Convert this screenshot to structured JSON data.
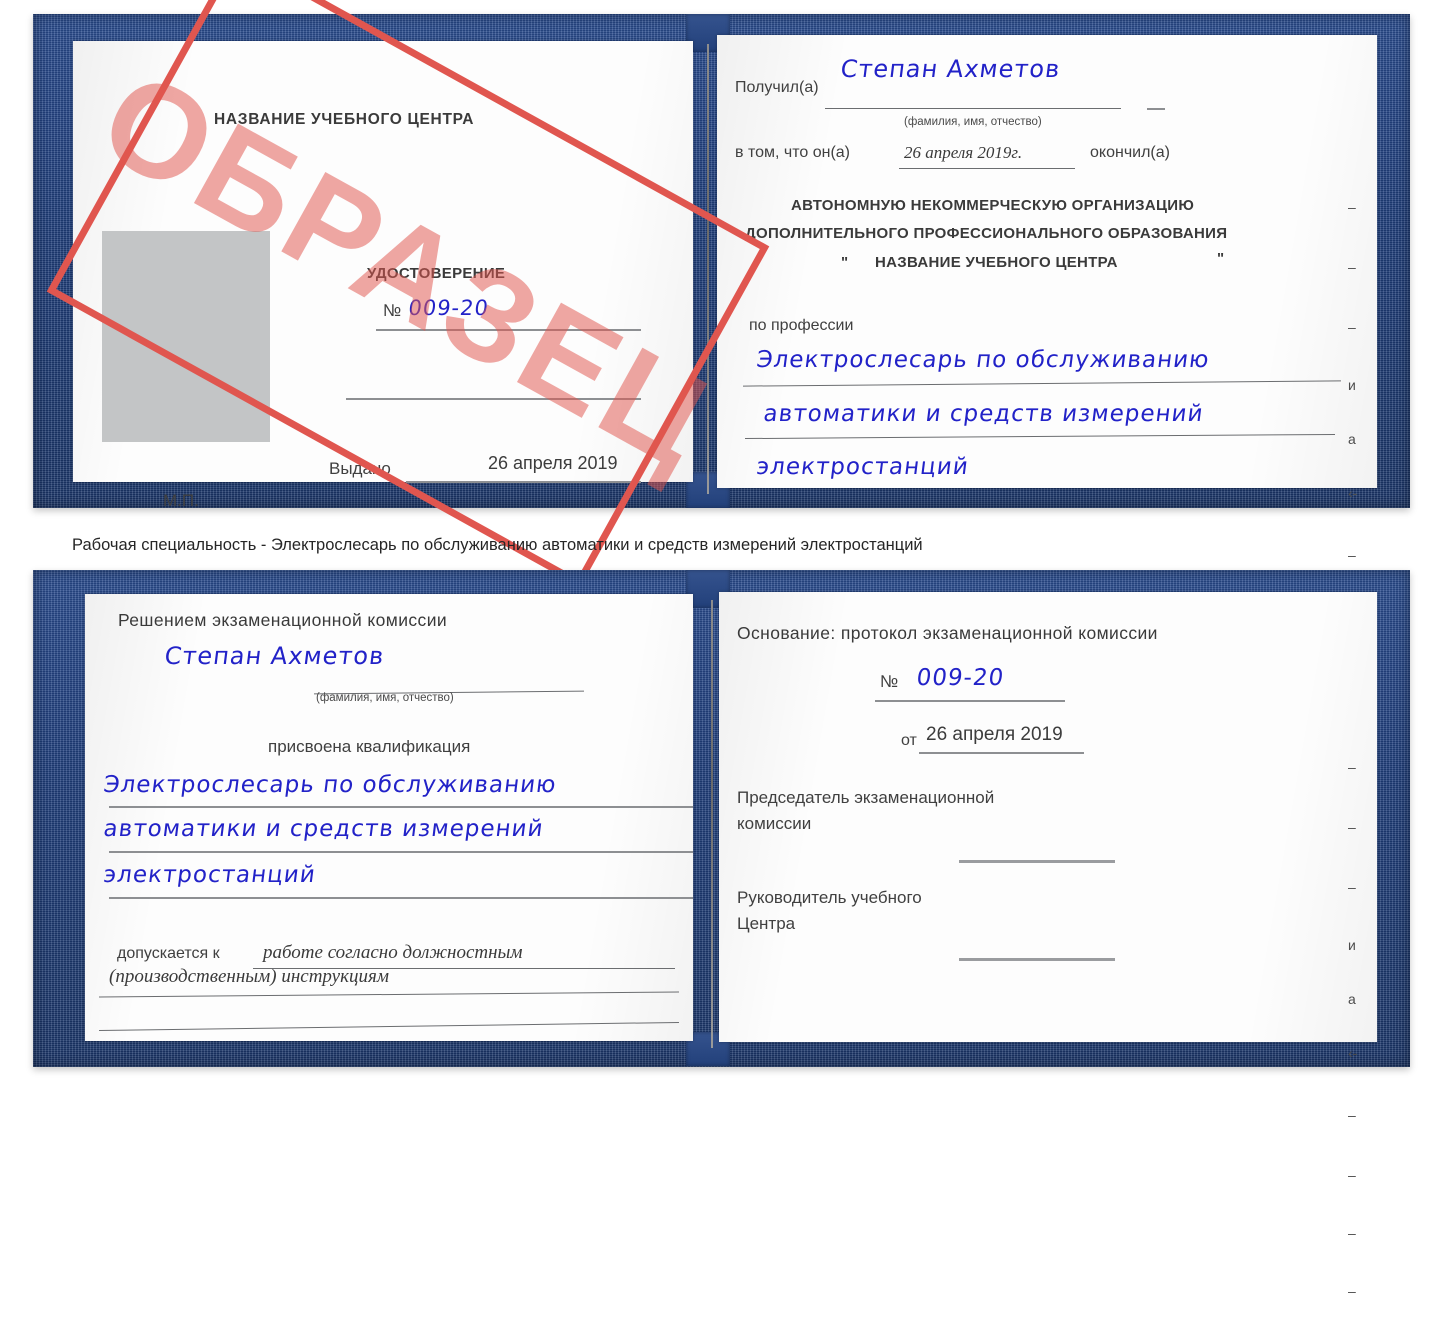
{
  "caption": {
    "text": "Рабочая специальность - Электрослесарь по обслуживанию автоматики и средств измерений электростанций"
  },
  "stamp": {
    "word": "ОБРАЗЕЦ",
    "color": "#e0564f"
  },
  "certificate_top": {
    "left_page": {
      "org_title": "НАЗВАНИЕ УЧЕБНОГО ЦЕНТРА",
      "doc_type": "УДОСТОВЕРЕНИЕ",
      "number_label": "№",
      "number_value": "009-20",
      "issued_label": "Выдано",
      "issued_value": "26 апреля 2019",
      "seal_label": "М.П."
    },
    "right_page": {
      "received_label": "Получил(а)",
      "received_value": "Степан Ахметов",
      "fio_hint": "(фамилия, имя, отчество)",
      "in_that_label": "в том, что он(а)",
      "in_that_value": "26 апреля 2019г.",
      "finished_label": "окончил(а)",
      "org_line1": "АВТОНОМНУЮ НЕКОММЕРЧЕСКУЮ ОРГАНИЗАЦИЮ",
      "org_line2": "ДОПОЛНИТЕЛЬНОГО ПРОФЕССИОНАЛЬНОГО ОБРАЗОВАНИЯ",
      "org_quote_open": "\"",
      "org_line3": "НАЗВАНИЕ УЧЕБНОГО ЦЕНТРА",
      "org_quote_close": "\"",
      "profession_label": "по профессии",
      "profession_line1": "Электрослесарь по обслуживанию",
      "profession_line2": "автоматики и средств измерений",
      "profession_line3": "электростанций",
      "edge_fragments": [
        "–",
        "–",
        "–",
        "и",
        "а",
        "‹-",
        "–",
        "–",
        "–",
        "–"
      ]
    }
  },
  "certificate_bottom": {
    "left_page": {
      "decision_title": "Решением экзаменационной комиссии",
      "name_value": "Степан Ахметов",
      "fio_hint": "(фамилия, имя, отчество)",
      "qualification_label": "присвоена квалификация",
      "qualification_line1": "Электрослесарь по обслуживанию",
      "qualification_line2": "автоматики и средств измерений",
      "qualification_line3": "электростанций",
      "admitted_label": "допускается к",
      "admitted_line1": "работе согласно должностным",
      "admitted_line2": "(производственным) инструкциям"
    },
    "right_page": {
      "basis_label": "Основание: протокол экзаменационной комиссии",
      "number_label": "№",
      "number_value": "009-20",
      "from_label": "от",
      "from_value": "26 апреля 2019",
      "chairman_line1": "Председатель экзаменационной",
      "chairman_line2": "комиссии",
      "director_line1": "Руководитель учебного",
      "director_line2": "Центра",
      "edge_fragments": [
        "–",
        "–",
        "–",
        "и",
        "а",
        "‹-",
        "–",
        "–",
        "–",
        "–"
      ]
    }
  }
}
